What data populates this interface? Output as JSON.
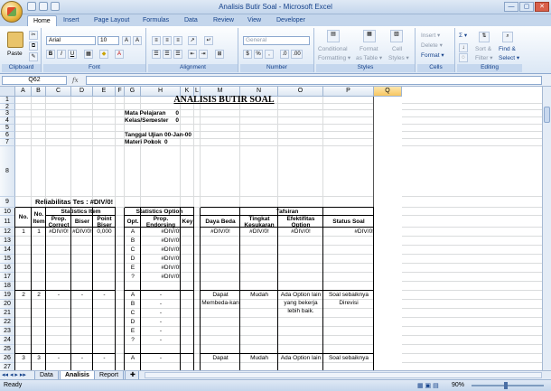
{
  "window": {
    "title": "Analisis Butir Soal - Microsoft Excel",
    "min": "—",
    "max": "▢",
    "close": "✕"
  },
  "tabs": [
    "Home",
    "Insert",
    "Page Layout",
    "Formulas",
    "Data",
    "Review",
    "View",
    "Developer"
  ],
  "ribbon": {
    "clipboard": {
      "label": "Clipboard",
      "paste": "Paste"
    },
    "font": {
      "label": "Font",
      "name": "Arial",
      "size": "10",
      "bold": "B",
      "italic": "I",
      "underline": "U",
      "grow": "A",
      "shrink": "A"
    },
    "alignment": {
      "label": "Alignment"
    },
    "number": {
      "label": "Number",
      "format": "General",
      "currency": "$",
      "percent": "%",
      "comma": ",",
      "inc": ".0",
      "dec": ".00"
    },
    "styles": {
      "label": "Styles",
      "conditional": "Conditional",
      "conditional2": "Formatting ▾",
      "format_table": "Format",
      "format_table2": "as Table ▾",
      "cell_styles": "Cell",
      "cell_styles2": "Styles ▾"
    },
    "cells": {
      "label": "Cells",
      "insert": "Insert ▾",
      "delete": "Delete ▾",
      "format": "Format ▾"
    },
    "editing": {
      "label": "Editing",
      "sum": "Σ ▾",
      "sort": "Sort &",
      "sort2": "Filter ▾",
      "find": "Find &",
      "find2": "Select ▾"
    }
  },
  "formula_bar": {
    "name_box": "Q62",
    "fx": "fx",
    "value": ""
  },
  "columns": [
    "A",
    "B",
    "C",
    "D",
    "E",
    "F",
    "G",
    "H",
    "K",
    "L",
    "M",
    "N",
    "O",
    "P",
    "Q"
  ],
  "rows": [
    "1",
    "2",
    "3",
    "4",
    "5",
    "6",
    "7",
    "8",
    "9",
    "10",
    "11",
    "12",
    "13",
    "14",
    "15",
    "16",
    "17",
    "18",
    "19",
    "20",
    "21",
    "22",
    "23",
    "24",
    "25",
    "26",
    "27"
  ],
  "sheet": {
    "title": "ANALISIS BUTIR SOAL",
    "mata_pelajaran_label": "Mata Pelajaran",
    "mata_pelajaran_value": "0",
    "kelas_label": "Kelas/Semester",
    "kelas_value": "0",
    "tanggal_label": "Tanggal Ujian",
    "tanggal_value": "00-Jan-00",
    "materi_label": "Materi Pokok",
    "materi_value": "0",
    "colon": ":",
    "reliabilitas": "Reliabilitas Tes : #DIV/0!",
    "hdr_no": "No.",
    "hdr_no_item": "No. Item",
    "hdr_stat_item": "Statistics Item",
    "hdr_prop_correct": "Prop. Correct",
    "hdr_biser": "Biser",
    "hdr_point_biser": "Point Biser",
    "hdr_stat_option": "Statistics Option",
    "hdr_opt": "Opt.",
    "hdr_prop_endorsing": "Prop. Endorsing",
    "hdr_key": "Key",
    "hdr_tafsiran": "Tafsiran",
    "hdr_daya_beda": "Daya Beda",
    "hdr_tingkat": "Tingkat Kesukaran",
    "hdr_efektifitas": "Efektifitas Option",
    "hdr_status": "Status Soal",
    "item1": {
      "no": "1",
      "item": "1",
      "prop": "#DIV/0!",
      "biser": "#DIV/0!",
      "point": "0,000",
      "daya": "#DIV/0!",
      "tingkat": "#DIV/0!",
      "efektif": "#DIV/0!",
      "status": "#DIV/0!"
    },
    "options": [
      "A",
      "B",
      "C",
      "D",
      "E",
      "?"
    ],
    "endorsing1": "#DIV/0!",
    "item2": {
      "no": "2",
      "item": "2",
      "prop": "-",
      "biser": "-",
      "point": "-",
      "daya": "Dapat Membeda-kan",
      "tingkat": "Mudah",
      "efektif": "Ada Option lain yang bekerja lebih baik.",
      "status": "Soal sebaiknya Direvisi"
    },
    "dash": "-",
    "item3": {
      "no": "3",
      "item": "3",
      "prop": "-",
      "biser": "-",
      "point": "-",
      "opt": "A",
      "endorse": "-",
      "daya": "Dapat",
      "tingkat": "Mudah",
      "efektif": "Ada Option lain",
      "status": "Soal sebaiknya"
    }
  },
  "sheet_tabs": [
    "Data",
    "Analisis",
    "Report"
  ],
  "status": {
    "ready": "Ready",
    "zoom": "90%"
  }
}
